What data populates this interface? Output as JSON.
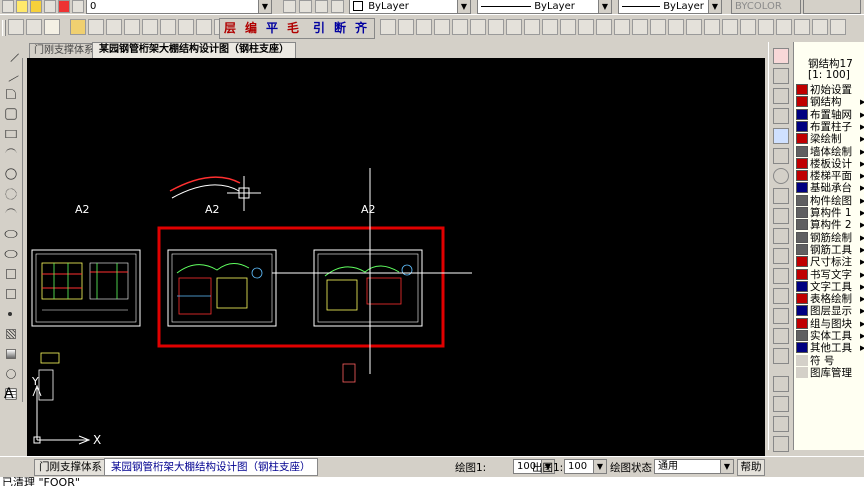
{
  "toolbar_top": {
    "layer_name": "0",
    "color_value": "ByLayer",
    "linetype_value": "ByLayer",
    "lineweight_value": "ByLayer",
    "plotstyle_value": "BYCOLOR"
  },
  "struct_toolbar": [
    "层",
    "编",
    "平",
    "毛",
    "引",
    "断",
    "齐"
  ],
  "tabs": {
    "tab1": "门刚支撑体系",
    "tab2": "某园钢管桁架大棚结构设计图（钢柱支座）"
  },
  "drawing": {
    "labels": [
      "A2",
      "A2",
      "A2"
    ],
    "axis_x": "X",
    "axis_y": "Y"
  },
  "right_menu": {
    "title": "钢结构17",
    "scale": "[1: 100]",
    "items": [
      {
        "label": "初始设置",
        "icon_color": "#c00000",
        "arrow": false
      },
      {
        "label": "钢结构",
        "icon_color": "#c00000",
        "arrow": true
      },
      {
        "label": "布置轴网",
        "icon_color": "#000080",
        "arrow": true
      },
      {
        "label": "布置柱子",
        "icon_color": "#000080",
        "arrow": true
      },
      {
        "label": "梁绘制",
        "icon_color": "#c00000",
        "arrow": true
      },
      {
        "label": "墙体绘制",
        "icon_color": "#606060",
        "arrow": true
      },
      {
        "label": "楼板设计",
        "icon_color": "#c00000",
        "arrow": true
      },
      {
        "label": "楼梯平面",
        "icon_color": "#c00000",
        "arrow": true
      },
      {
        "label": "基础承台",
        "icon_color": "#000080",
        "arrow": true
      },
      {
        "label": "构件绘图",
        "icon_color": "#606060",
        "arrow": true
      },
      {
        "label": "算构件 1",
        "icon_color": "#606060",
        "arrow": true
      },
      {
        "label": "算构件 2",
        "icon_color": "#606060",
        "arrow": true
      },
      {
        "label": "钢筋绘制",
        "icon_color": "#606060",
        "arrow": true
      },
      {
        "label": "钢筋工具",
        "icon_color": "#606060",
        "arrow": true
      },
      {
        "label": "尺寸标注",
        "icon_color": "#c00000",
        "arrow": true
      },
      {
        "label": "书写文字",
        "icon_color": "#c00000",
        "arrow": true
      },
      {
        "label": "文字工具",
        "icon_color": "#000080",
        "arrow": true
      },
      {
        "label": "表格绘制",
        "icon_color": "#c00000",
        "arrow": true
      },
      {
        "label": "图层显示",
        "icon_color": "#000080",
        "arrow": true
      },
      {
        "label": "组与图块",
        "icon_color": "#c00000",
        "arrow": true
      },
      {
        "label": "实体工具",
        "icon_color": "#606060",
        "arrow": true
      },
      {
        "label": "其他工具",
        "icon_color": "#000080",
        "arrow": true
      },
      {
        "label": "符  号",
        "icon_color": "#d4d0c8",
        "arrow": false
      },
      {
        "label": "图库管理",
        "icon_color": "#d4d0c8",
        "arrow": false
      }
    ]
  },
  "status_bar": {
    "layout_tab1": "门刚支撑体系",
    "layout_tab2": "某园钢管桁架大棚结构设计图（钢柱支座）",
    "draw_scale_label": "绘图1:",
    "draw_scale_value": "100",
    "out_scale_label": "出图1:",
    "out_scale_value": "100",
    "state_label": "绘图状态",
    "state_value": "通用",
    "help_label": "帮助"
  },
  "command_line": "已清理 \"FOOR\" ",
  "colors": {
    "canvas": "#000000",
    "highlight_box": "#e00000",
    "window_face": "#d4d0c8",
    "menu_bg": "#fffff2"
  }
}
